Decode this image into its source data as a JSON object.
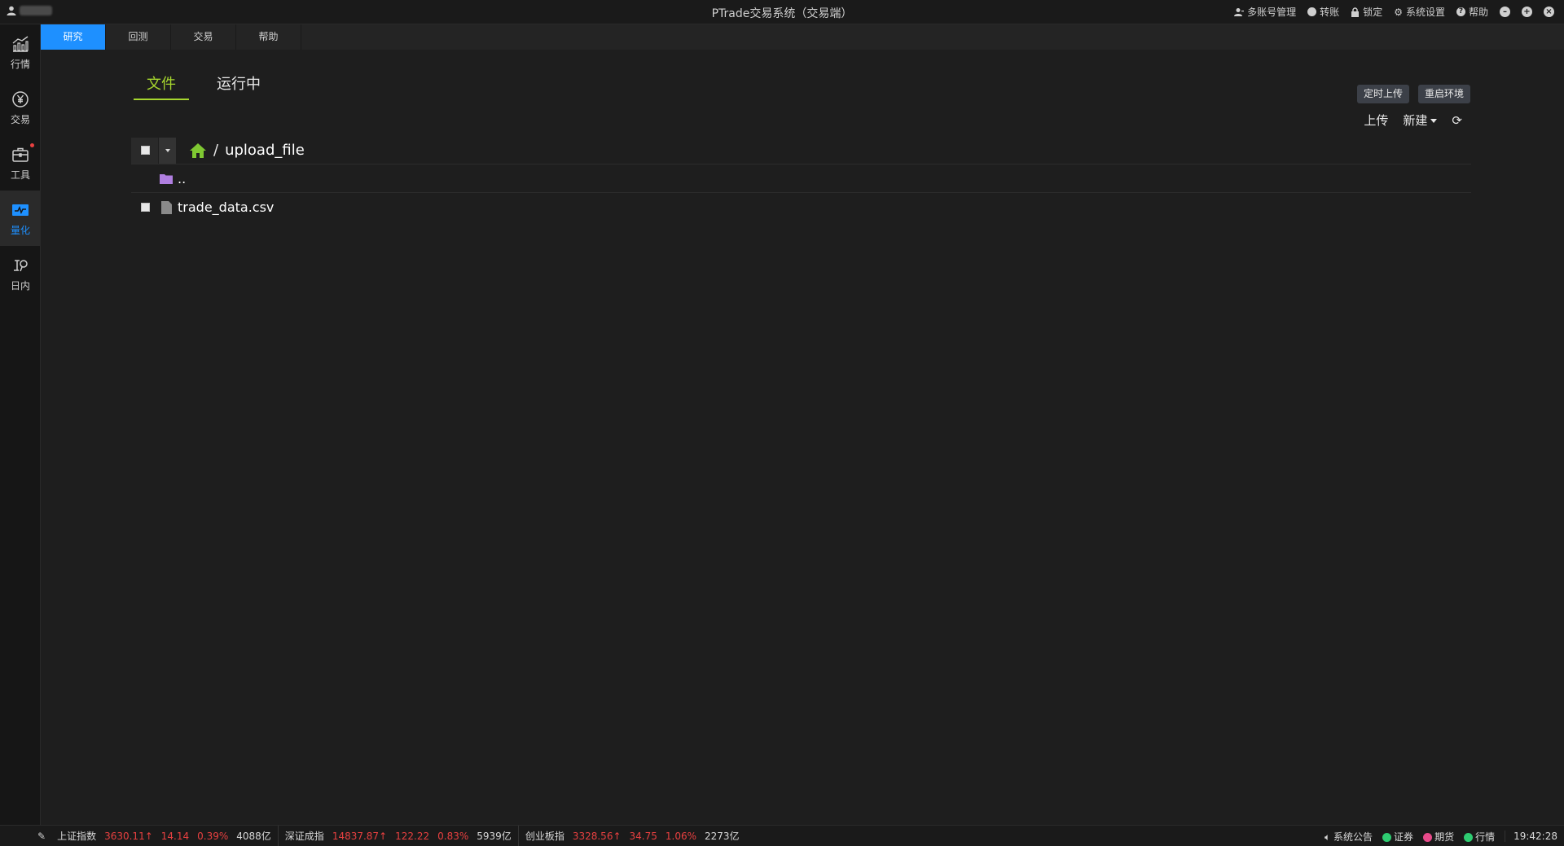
{
  "window": {
    "title": "PTrade交易系统（交易端）",
    "tools": [
      {
        "label": "多账号管理",
        "icon": "accounts-icon"
      },
      {
        "label": "转账",
        "icon": "transfer-icon"
      },
      {
        "label": "锁定",
        "icon": "lock-icon"
      },
      {
        "label": "系统设置",
        "icon": "gear-icon"
      },
      {
        "label": "帮助",
        "icon": "help-icon"
      }
    ]
  },
  "sidebar": {
    "items": [
      {
        "label": "行情",
        "icon": "chart-icon"
      },
      {
        "label": "交易",
        "icon": "yen-icon"
      },
      {
        "label": "工具",
        "icon": "toolbox-icon"
      },
      {
        "label": "量化",
        "icon": "quant-icon",
        "active": true
      },
      {
        "label": "日内",
        "icon": "intraday-icon"
      }
    ]
  },
  "tabs": [
    {
      "label": "研究",
      "active": true
    },
    {
      "label": "回测"
    },
    {
      "label": "交易"
    },
    {
      "label": "帮助"
    }
  ],
  "research": {
    "subtabs": [
      {
        "label": "文件",
        "active": true
      },
      {
        "label": "运行中"
      }
    ],
    "buttons": {
      "scheduled_upload": "定时上传",
      "restart_env": "重启环境",
      "upload": "上传",
      "new": "新建"
    },
    "breadcrumb": {
      "separator": "/",
      "folder": "upload_file"
    },
    "files": [
      {
        "name": "..",
        "type": "folder"
      },
      {
        "name": "trade_data.csv",
        "type": "file"
      }
    ]
  },
  "statusbar": {
    "indices": [
      {
        "name": "上证指数",
        "value": "3630.11",
        "change": "14.14",
        "pct": "0.39%",
        "volume": "4088亿"
      },
      {
        "name": "深证成指",
        "value": "14837.87",
        "change": "122.22",
        "pct": "0.83%",
        "volume": "5939亿"
      },
      {
        "name": "创业板指",
        "value": "3328.56",
        "change": "34.75",
        "pct": "1.06%",
        "volume": "2273亿"
      }
    ],
    "announcement": "系统公告",
    "connections": [
      {
        "label": "证券",
        "color": "#2ecc71"
      },
      {
        "label": "期货",
        "color": "#e84a8a"
      },
      {
        "label": "行情",
        "color": "#2ecc71"
      }
    ],
    "time": "19:42:28"
  }
}
